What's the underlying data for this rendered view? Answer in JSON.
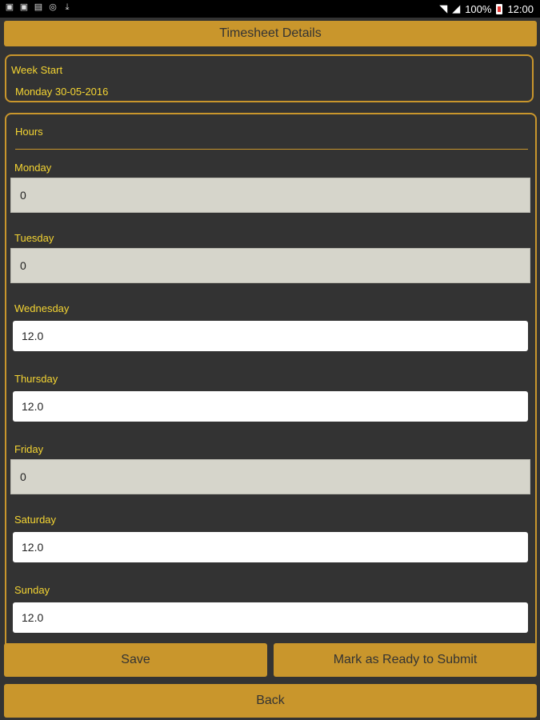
{
  "status_bar": {
    "battery": "100%",
    "time": "12:00",
    "notification_icons": [
      "screenshot-icon",
      "screenshot-icon",
      "image-icon",
      "circle-icon",
      "download-icon"
    ]
  },
  "header": {
    "title": "Timesheet Details"
  },
  "week": {
    "label": "Week Start",
    "value": "Monday 30-05-2016"
  },
  "hours": {
    "title": "Hours",
    "days": [
      {
        "label": "Monday",
        "value": "0",
        "editable": false
      },
      {
        "label": "Tuesday",
        "value": "0",
        "editable": false
      },
      {
        "label": "Wednesday",
        "value": "12.0",
        "editable": true
      },
      {
        "label": "Thursday",
        "value": "12.0",
        "editable": true
      },
      {
        "label": "Friday",
        "value": "0",
        "editable": false
      },
      {
        "label": "Saturday",
        "value": "12.0",
        "editable": true
      },
      {
        "label": "Sunday",
        "value": "12.0",
        "editable": true
      }
    ]
  },
  "buttons": {
    "save": "Save",
    "ready": "Mark as Ready to Submit",
    "back": "Back"
  },
  "colors": {
    "accent": "#c9962c",
    "label": "#f5d533",
    "background": "#333333",
    "disabled_field": "#d6d5cb"
  }
}
